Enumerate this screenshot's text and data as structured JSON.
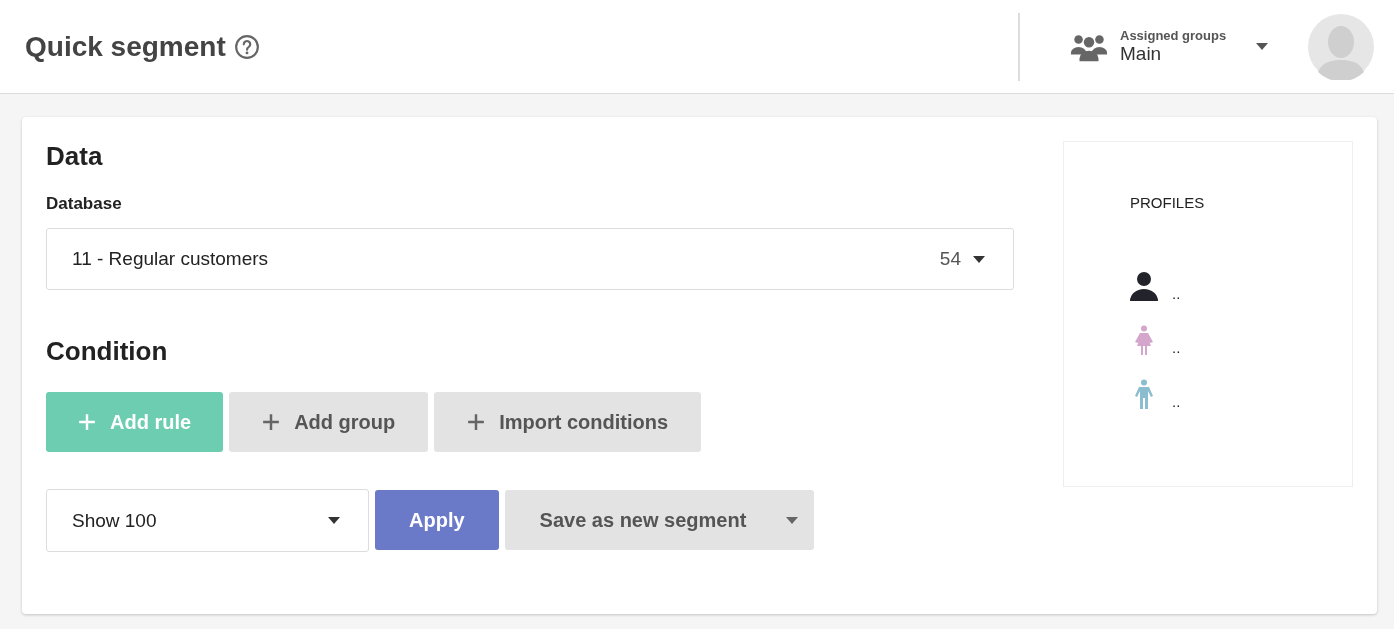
{
  "header": {
    "title": "Quick segment",
    "groups": {
      "label": "Assigned groups",
      "value": "Main"
    }
  },
  "data_section": {
    "title": "Data",
    "database": {
      "label": "Database",
      "value": "11 - Regular customers",
      "count": "54"
    }
  },
  "condition_section": {
    "title": "Condition",
    "buttons": [
      {
        "label": "Add rule",
        "kind": "primary"
      },
      {
        "label": "Add group",
        "kind": "secondary"
      },
      {
        "label": "Import conditions",
        "kind": "secondary"
      }
    ]
  },
  "footer": {
    "show": {
      "value": "Show 100"
    },
    "apply": "Apply",
    "save": "Save as new segment"
  },
  "profiles": {
    "title": "PROFILES",
    "items": [
      {
        "kind": "person",
        "color": "#22232b",
        "value": ".."
      },
      {
        "kind": "female",
        "color": "#d4a6cc",
        "value": ".."
      },
      {
        "kind": "male",
        "color": "#8bbdd1",
        "value": ".."
      }
    ]
  }
}
